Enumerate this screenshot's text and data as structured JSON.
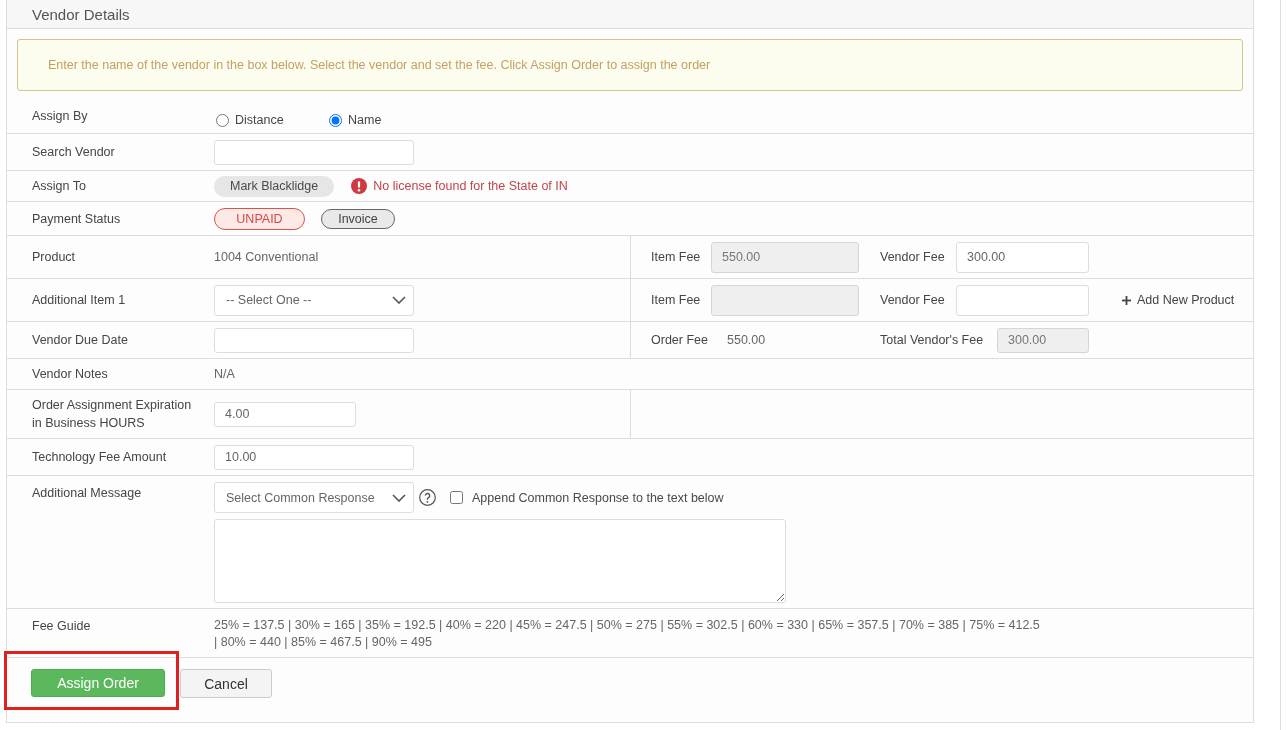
{
  "panel": {
    "title": "Vendor Details"
  },
  "alert": {
    "text": "Enter the name of the vendor in the box below. Select the vendor and set the fee. Click Assign Order to assign the order"
  },
  "assign_by": {
    "label": "Assign By",
    "options": [
      {
        "label": "Distance",
        "selected": false
      },
      {
        "label": "Name",
        "selected": true
      }
    ]
  },
  "search_vendor": {
    "label": "Search Vendor"
  },
  "assign_to": {
    "label": "Assign To",
    "vendor": "Mark Blacklidge",
    "warning": "No license found for the State of IN"
  },
  "payment_status": {
    "label": "Payment Status",
    "status": "UNPAID",
    "action": "Invoice"
  },
  "product": {
    "label": "Product",
    "value": "1004 Conventional",
    "item_fee": {
      "label": "Item Fee",
      "value": "550.00",
      "disabled": true
    },
    "vendor_fee": {
      "label": "Vendor Fee",
      "value": "300.00",
      "disabled": false
    }
  },
  "additional_item": {
    "label": "Additional Item 1",
    "select": "-- Select One --",
    "item_fee": {
      "label": "Item Fee",
      "disabled": true
    },
    "vendor_fee": {
      "label": "Vendor Fee",
      "disabled": false
    },
    "add_link": "Add New Product"
  },
  "due_date": {
    "label": "Vendor Due Date",
    "order_fee": {
      "label": "Order Fee",
      "value": "550.00"
    },
    "total_fee": {
      "label": "Total Vendor's Fee",
      "value": "300.00",
      "disabled": true
    }
  },
  "notes": {
    "label": "Vendor Notes",
    "value": "N/A"
  },
  "expiration": {
    "label": "Order Assignment Expiration in Business HOURS",
    "value": "4.00"
  },
  "tech_fee": {
    "label": "Technology Fee Amount",
    "value": "10.00"
  },
  "message": {
    "label": "Additional Message",
    "select": "Select Common Response",
    "append": {
      "label": "Append Common Response to the text below",
      "checked": false
    }
  },
  "fee_guide": {
    "label": "Fee Guide",
    "text": "25% = 137.5 | 30% = 165 | 35% = 192.5 | 40% = 220 | 45% = 247.5 | 50% = 275 | 55% = 302.5 | 60% = 330 | 65% = 357.5 | 70% = 385 | 75% = 412.5 | 80% = 440 | 85% = 467.5 | 90% = 495"
  },
  "buttons": [
    {
      "label": "Assign Order",
      "kind": "primary",
      "highlighted": true
    },
    {
      "label": "Cancel",
      "kind": "default",
      "highlighted": false
    }
  ]
}
